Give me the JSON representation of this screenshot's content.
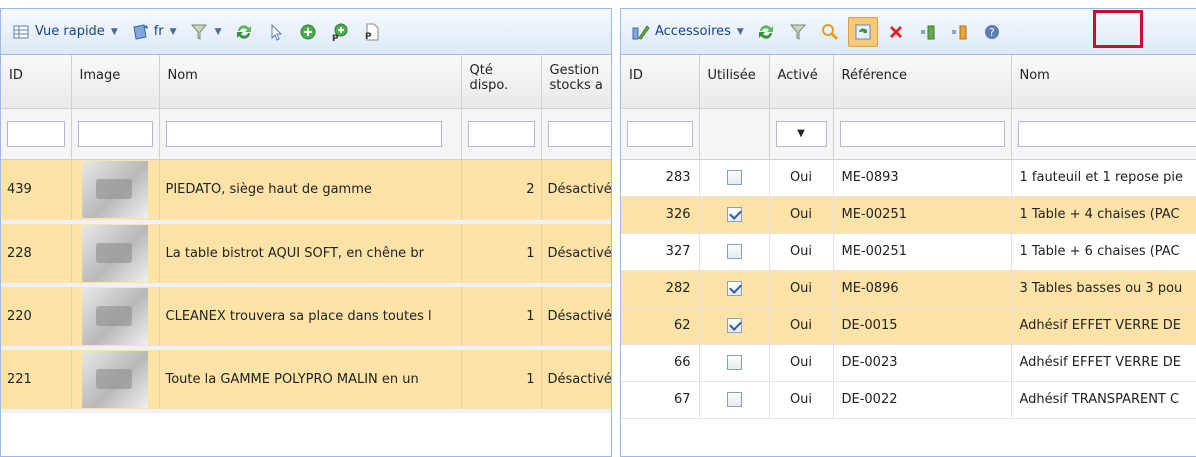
{
  "left": {
    "toolbar": {
      "view_label": "Vue rapide",
      "lang_label": "fr"
    },
    "columns": [
      "ID",
      "Image",
      "Nom",
      "Qté dispo.",
      "Gestion stocks a"
    ],
    "rows": [
      {
        "id": "439",
        "name": "PIEDATO, siège haut de gamme",
        "qty": "2",
        "stock": "Désactivé"
      },
      {
        "id": "228",
        "name": "La table bistrot AQUI SOFT, en chêne br",
        "qty": "1",
        "stock": "Désactivé"
      },
      {
        "id": "220",
        "name": "CLEANEX trouvera sa place dans toutes l",
        "qty": "1",
        "stock": "Désactivé"
      },
      {
        "id": "221",
        "name": "Toute la GAMME POLYPRO MALIN en un",
        "qty": "1",
        "stock": "Désactivé"
      }
    ]
  },
  "right": {
    "toolbar": {
      "section_label": "Accessoires"
    },
    "columns": [
      "ID",
      "Utilisée",
      "Activé",
      "Référence",
      "Nom"
    ],
    "rows": [
      {
        "id": "283",
        "used": false,
        "active": "Oui",
        "ref": "ME-0893",
        "name": "1 fauteuil et 1 repose pie"
      },
      {
        "id": "326",
        "used": true,
        "active": "Oui",
        "ref": "ME-00251",
        "name": "1 Table + 4 chaises (PAC"
      },
      {
        "id": "327",
        "used": false,
        "active": "Oui",
        "ref": "ME-00251",
        "name": "1 Table + 6 chaises (PAC"
      },
      {
        "id": "282",
        "used": true,
        "active": "Oui",
        "ref": "ME-0896",
        "name": "3 Tables basses ou 3 pou"
      },
      {
        "id": "62",
        "used": true,
        "active": "Oui",
        "ref": "DE-0015",
        "name": "Adhésif EFFET VERRE DE"
      },
      {
        "id": "66",
        "used": false,
        "active": "Oui",
        "ref": "DE-0023",
        "name": "Adhésif EFFET VERRE DE"
      },
      {
        "id": "67",
        "used": false,
        "active": "Oui",
        "ref": "DE-0022",
        "name": "Adhésif TRANSPARENT C"
      }
    ]
  },
  "colors": {
    "selected_row": "#fde3a7",
    "toolbar_bg": "#dde9f6",
    "highlight": "#c8102e"
  }
}
